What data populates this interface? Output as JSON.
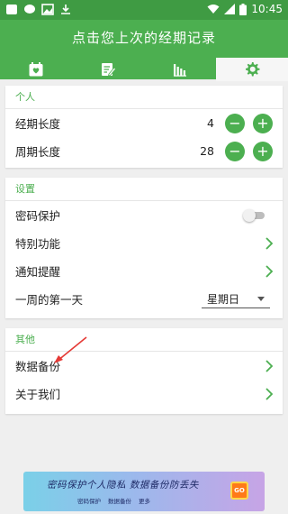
{
  "status_bar": {
    "time": "10:45",
    "icons": [
      "notification-icon",
      "chat-icon",
      "gallery-icon",
      "download-icon",
      "wifi-icon",
      "signal-icon",
      "battery-icon"
    ]
  },
  "header": {
    "title": "点击您上次的经期记录",
    "tabs": [
      {
        "icon": "calendar-icon",
        "active": false
      },
      {
        "icon": "note-edit-icon",
        "active": false
      },
      {
        "icon": "bar-chart-icon",
        "active": false
      },
      {
        "icon": "gear-icon",
        "active": true
      }
    ]
  },
  "personal": {
    "section_title": "个人",
    "period_length": {
      "label": "经期长度",
      "value": "4"
    },
    "cycle_length": {
      "label": "周期长度",
      "value": "28"
    },
    "minus_symbol": "−",
    "plus_symbol": "+"
  },
  "settings": {
    "section_title": "设置",
    "password": {
      "label": "密码保护",
      "enabled": false
    },
    "special": {
      "label": "特别功能"
    },
    "notify": {
      "label": "通知提醒"
    },
    "week_start": {
      "label": "一周的第一天",
      "value": "星期日"
    }
  },
  "other": {
    "section_title": "其他",
    "backup": {
      "label": "数据备份"
    },
    "about": {
      "label": "关于我们"
    }
  },
  "banner": {
    "headline": "密码保护个人隐私  数据备份防丢失",
    "tags": [
      "密码保护",
      "数据备份",
      "更多"
    ],
    "go_label": "GO"
  },
  "colors": {
    "primary": "#4caf50",
    "status_bar": "#3f9b43",
    "annotation": "#e53935"
  }
}
